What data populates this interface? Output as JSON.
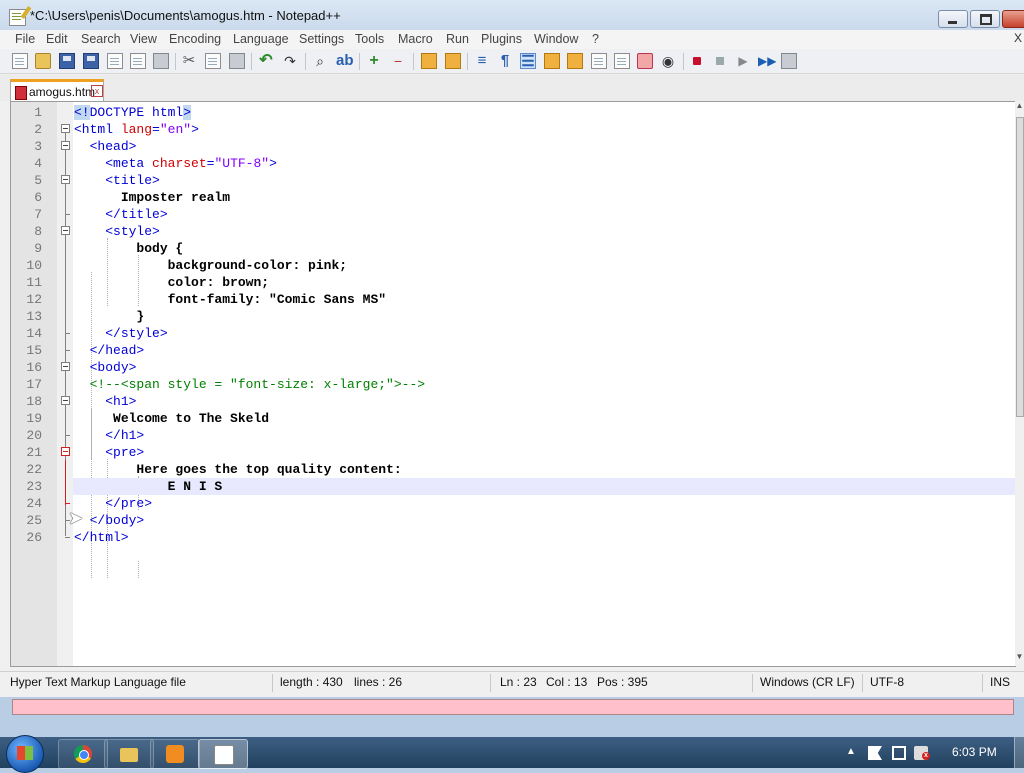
{
  "window": {
    "title": "*C:\\Users\\penis\\Documents\\amogus.htm - Notepad++"
  },
  "menu": [
    "File",
    "Edit",
    "Search",
    "View",
    "Encoding",
    "Language",
    "Settings",
    "Tools",
    "Macro",
    "Run",
    "Plugins",
    "Window",
    "?"
  ],
  "menu_close": "X",
  "tab": {
    "label": "amogus.htm",
    "close": "x"
  },
  "editor": {
    "lines": [
      {
        "n": "1",
        "html": "<span class=\"tag hl-doctype\">&lt;!</span><span class=\"tag\">DOCTYPE html</span><span class=\"tag hl-doctype\">&gt;</span>"
      },
      {
        "n": "2",
        "html": "<span class=\"tag\">&lt;html</span> <span class=\"attr\">lang</span><span class=\"tag\">=</span><span class=\"str\">\"en\"</span><span class=\"tag\">&gt;</span>"
      },
      {
        "n": "3",
        "html": "  <span class=\"tag\">&lt;head&gt;</span>"
      },
      {
        "n": "4",
        "html": "    <span class=\"tag\">&lt;meta</span> <span class=\"attr\">charset</span><span class=\"tag\">=</span><span class=\"str\">\"UTF-8\"</span><span class=\"tag\">&gt;</span>"
      },
      {
        "n": "5",
        "html": "    <span class=\"tag\">&lt;title&gt;</span>"
      },
      {
        "n": "6",
        "html": "      <span class=\"bold\">Imposter realm</span>"
      },
      {
        "n": "7",
        "html": "    <span class=\"tag\">&lt;/title&gt;</span>"
      },
      {
        "n": "8",
        "html": "    <span class=\"tag\">&lt;style&gt;</span>"
      },
      {
        "n": "9",
        "html": "        <span class=\"bold\">body {</span>"
      },
      {
        "n": "10",
        "html": "            <span class=\"bold\">background-color: pink;</span>"
      },
      {
        "n": "11",
        "html": "            <span class=\"bold\">color: brown;</span>"
      },
      {
        "n": "12",
        "html": "            <span class=\"bold\">font-family: \"Comic Sans MS\"</span>"
      },
      {
        "n": "13",
        "html": "        <span class=\"bold\">}</span>"
      },
      {
        "n": "14",
        "html": "    <span class=\"tag\">&lt;/style&gt;</span>"
      },
      {
        "n": "15",
        "html": "  <span class=\"tag\">&lt;/head&gt;</span>"
      },
      {
        "n": "16",
        "html": "  <span class=\"tag\">&lt;body&gt;</span>"
      },
      {
        "n": "17",
        "html": "  <span class=\"cmt\">&lt;!--&lt;span style = \"font-size: x-large;\"&gt;--&gt;</span>"
      },
      {
        "n": "18",
        "html": "    <span class=\"tag\">&lt;h1&gt;</span>"
      },
      {
        "n": "19",
        "html": "     <span class=\"bold\">Welcome to The Skeld</span>"
      },
      {
        "n": "20",
        "html": "    <span class=\"tag\">&lt;/h1&gt;</span>"
      },
      {
        "n": "21",
        "html": "    <span class=\"tag\">&lt;pre&gt;</span>"
      },
      {
        "n": "22",
        "html": "        <span class=\"bold\">Here goes the top quality content:</span>"
      },
      {
        "n": "23",
        "html": "            <span class=\"bold\">E N I S</span>"
      },
      {
        "n": "24",
        "html": "    <span class=\"tag\">&lt;/pre&gt;</span>"
      },
      {
        "n": "25",
        "html": "  <span class=\"tag\">&lt;/body&gt;</span>"
      },
      {
        "n": "26",
        "html": "<span class=\"tag\">&lt;/html&gt;</span>"
      }
    ],
    "current_line": "23"
  },
  "status": {
    "filetype": "Hyper Text Markup Language file",
    "length": "length : 430",
    "lines": "lines : 26",
    "ln": "Ln : 23",
    "col": "Col : 13",
    "pos": "Pos : 395",
    "eol": "Windows (CR LF)",
    "encoding": "UTF-8",
    "mode": "INS"
  },
  "taskbar": {
    "clock": "6:03 PM",
    "tray_arrow": "▲"
  },
  "toolbar_icons": [
    "new-file-icon",
    "open-file-icon",
    "save-icon",
    "save-all-icon",
    "close-icon",
    "close-all-icon",
    "print-icon",
    "cut-icon",
    "copy-icon",
    "paste-icon",
    "undo-icon",
    "redo-icon",
    "find-icon",
    "replace-icon",
    "zoom-in-icon",
    "zoom-out-icon",
    "sync-v-icon",
    "sync-h-icon",
    "wrap-icon",
    "all-chars-icon",
    "indent-guide-icon",
    "udl-icon",
    "doc-map-icon",
    "function-list-icon",
    "folder-workspace-icon",
    "monitor-icon",
    "record-icon",
    "stop-icon",
    "play-icon",
    "play-multiple-icon",
    "save-macro-icon"
  ],
  "colors": {
    "tab_accent": "#f0a020",
    "current_line": "#e8e8ff",
    "tag": "#0000d6",
    "attribute": "#d00000",
    "string": "#8000ff",
    "comment": "#008000",
    "pink_strip": "#ffc0cb"
  }
}
